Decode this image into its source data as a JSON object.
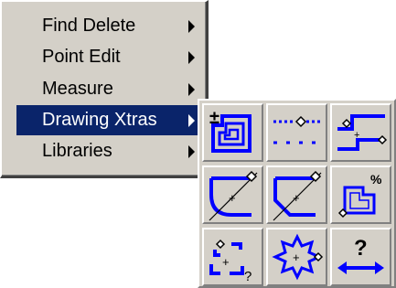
{
  "menu": {
    "items": [
      {
        "label": "Find Delete",
        "selected": false
      },
      {
        "label": "Point Edit",
        "selected": false
      },
      {
        "label": "Measure",
        "selected": false
      },
      {
        "label": "Drawing Xtras",
        "selected": true
      },
      {
        "label": "Libraries",
        "selected": false
      }
    ],
    "selection_color": "#0a246a"
  },
  "drawing_xtras_palette": {
    "tools": [
      {
        "icon": "outline-offset-icon"
      },
      {
        "icon": "dashed-line-icon"
      },
      {
        "icon": "step-line-icon"
      },
      {
        "icon": "fillet-corner-icon"
      },
      {
        "icon": "chamfer-corner-icon"
      },
      {
        "icon": "scaled-outline-icon"
      },
      {
        "icon": "bracket-text-icon",
        "caption": "?"
      },
      {
        "icon": "starburst-icon"
      },
      {
        "icon": "distance-measure-icon",
        "caption": "?"
      }
    ],
    "icon_color": "#0000ff"
  }
}
